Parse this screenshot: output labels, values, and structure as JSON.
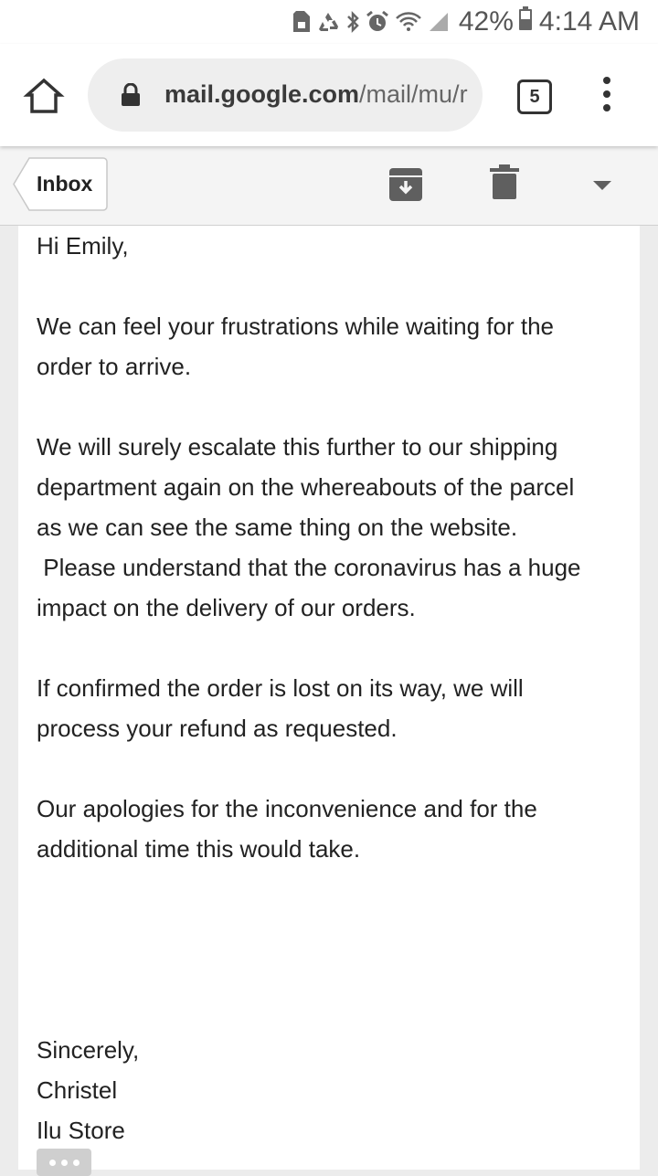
{
  "status_bar": {
    "battery_percent": "42%",
    "time": "4:14 AM",
    "icons": [
      "sim-icon",
      "recycle-icon",
      "bluetooth-icon",
      "alarm-icon",
      "wifi-icon",
      "signal-icon",
      "battery-icon"
    ]
  },
  "browser": {
    "url_domain": "mail.google.com",
    "url_path": "/mail/mu/r",
    "tab_count": "5"
  },
  "toolbar": {
    "back_label": "Inbox"
  },
  "email": {
    "lines": [
      "Hi Emily,",
      "",
      "We can feel your frustrations while waiting for the",
      "order to arrive.",
      "",
      "We will surely escalate this further to our shipping",
      "department again on the whereabouts of the parcel",
      "as we can see the same thing on the website.",
      " Please understand that the coronavirus has a huge",
      "impact on the delivery of our orders.",
      "",
      "If confirmed the order is lost on its way, we will",
      "process your refund as requested.",
      "",
      "Our apologies for the inconvenience and for the",
      "additional time this would take.",
      "",
      "",
      "",
      "",
      "Sincerely,",
      "Christel",
      "Ilu Store"
    ]
  },
  "colors": {
    "toolbar_bg": "#f4f4f4",
    "page_bg": "#ececec",
    "icon_gray": "#5f5f5f",
    "text": "#222222"
  }
}
